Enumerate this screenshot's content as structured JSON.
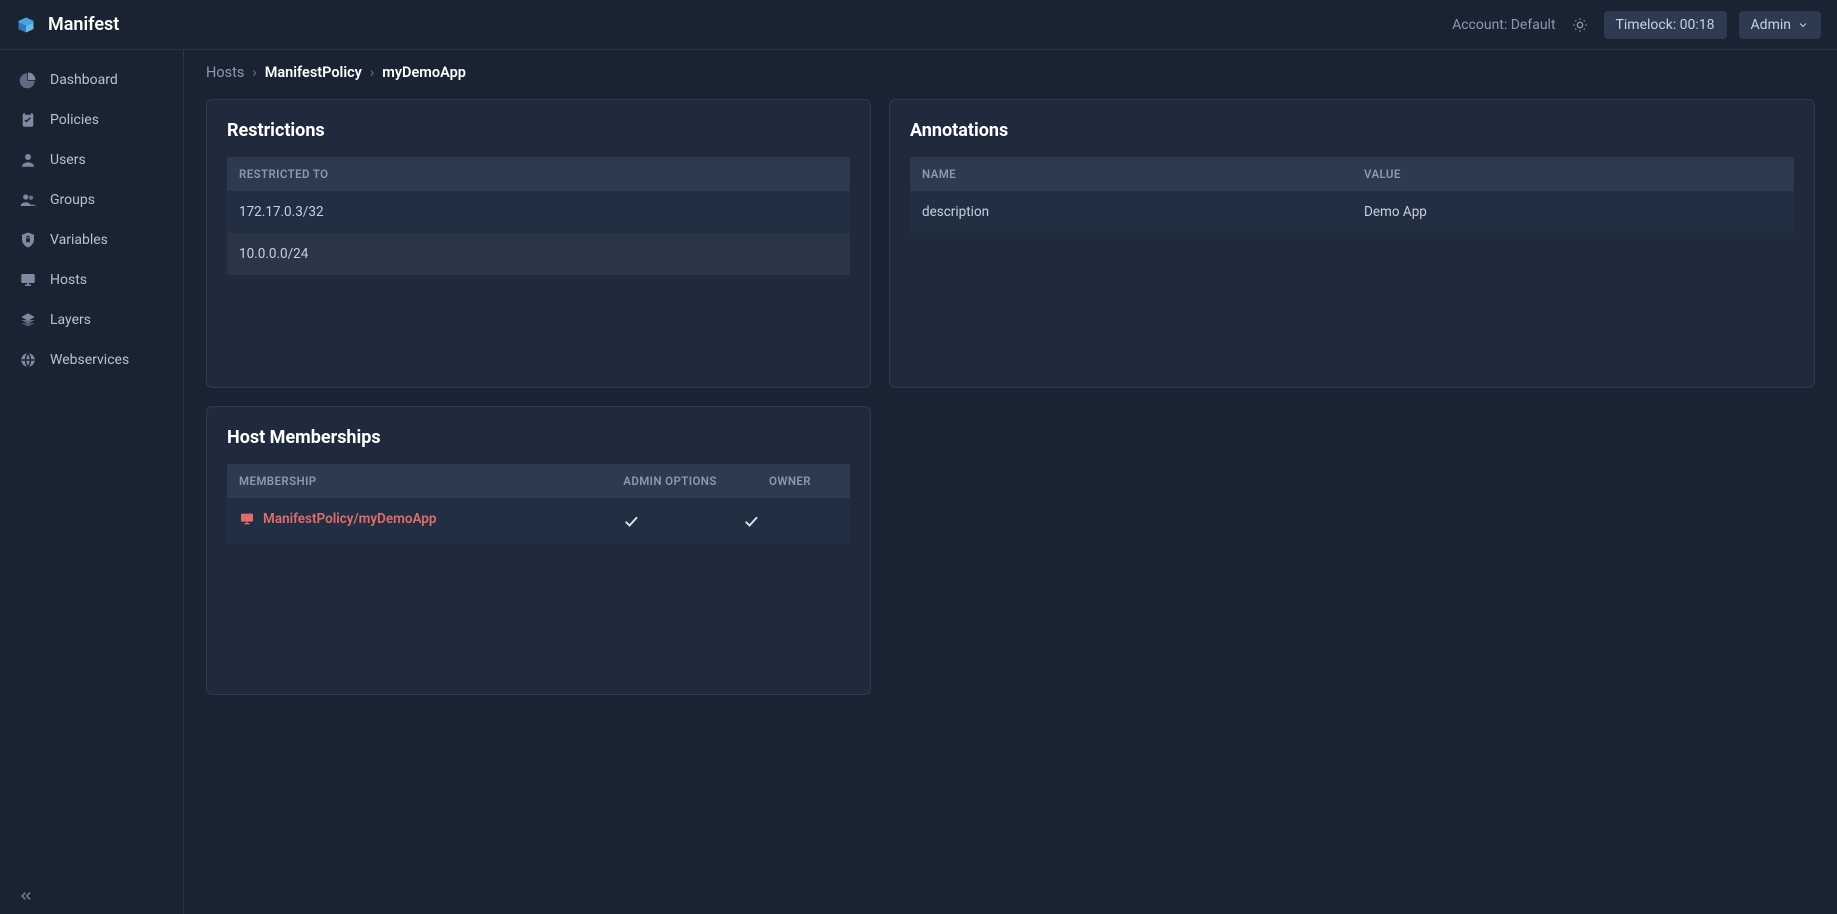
{
  "brand": {
    "name": "Manifest"
  },
  "header": {
    "account_label": "Account: Default",
    "timelock": "Timelock: 00:18",
    "user": "Admin"
  },
  "sidebar": {
    "items": [
      {
        "label": "Dashboard"
      },
      {
        "label": "Policies"
      },
      {
        "label": "Users"
      },
      {
        "label": "Groups"
      },
      {
        "label": "Variables"
      },
      {
        "label": "Hosts"
      },
      {
        "label": "Layers"
      },
      {
        "label": "Webservices"
      }
    ]
  },
  "breadcrumb": {
    "root": "Hosts",
    "policy": "ManifestPolicy",
    "item": "myDemoApp"
  },
  "restrictions": {
    "title": "Restrictions",
    "col": "RESTRICTED TO",
    "rows": [
      "172.17.0.3/32",
      "10.0.0.0/24"
    ]
  },
  "annotations": {
    "title": "Annotations",
    "col_name": "NAME",
    "col_value": "VALUE",
    "rows": [
      {
        "name": "description",
        "value": "Demo App"
      }
    ]
  },
  "memberships": {
    "title": "Host Memberships",
    "col_membership": "MEMBERSHIP",
    "col_admin": "ADMIN OPTIONS",
    "col_owner": "OWNER",
    "rows": [
      {
        "name": "ManifestPolicy/myDemoApp",
        "admin": true,
        "owner": true
      }
    ]
  }
}
